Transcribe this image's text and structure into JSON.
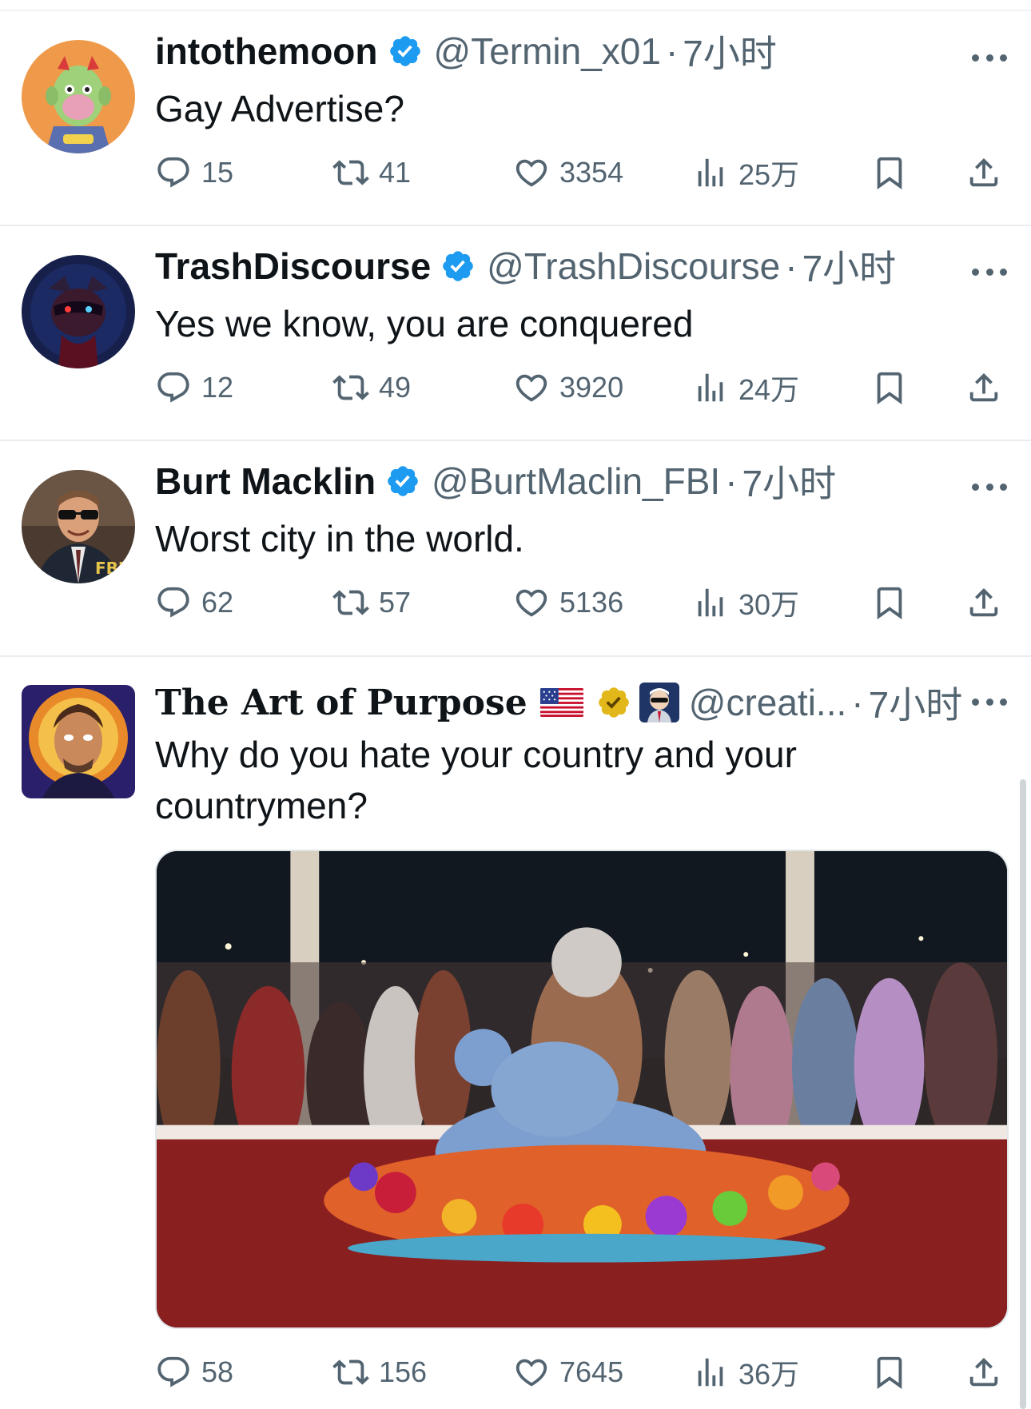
{
  "tweets": [
    {
      "display_name": "intothemoon",
      "handle": "@Termin_x01",
      "dot": "·",
      "time": "7小时",
      "text": "Gay Advertise?",
      "replies": "15",
      "reposts": "41",
      "likes": "3354",
      "views": "25万",
      "avatar_icon": "cartoon-ape-avatar",
      "badge": "verified-blue"
    },
    {
      "display_name": "TrashDiscourse",
      "handle": "@TrashDiscourse",
      "dot": "·",
      "time": "7小时",
      "text": "Yes we know, you are conquered",
      "replies": "12",
      "reposts": "49",
      "likes": "3920",
      "views": "24万",
      "avatar_icon": "raccoon-avatar",
      "badge": "verified-blue"
    },
    {
      "display_name": "Burt Macklin",
      "handle": "@BurtMaclin_FBI",
      "dot": "·",
      "time": "7小时",
      "text": "Worst city in the world.",
      "replies": "62",
      "reposts": "57",
      "likes": "5136",
      "views": "30万",
      "avatar_icon": "man-sunglasses-avatar",
      "badge": "verified-blue",
      "avatar_text": "FBI"
    },
    {
      "display_name": "The Art of Purpose",
      "handle": "@creati...",
      "dot": "·",
      "time": "7小时",
      "text": "Why do you hate your country and your countrymen?",
      "replies": "58",
      "reposts": "156",
      "likes": "7645",
      "views": "36万",
      "avatar_icon": "glowing-face-avatar",
      "badge": "verified-gold",
      "emoji": [
        "us-flag",
        "affiliate-avatar"
      ],
      "media": "photo-performers-banquet-table"
    }
  ],
  "icons": {
    "reply": "reply-icon",
    "repost": "repost-icon",
    "like": "heart-icon",
    "views": "views-icon",
    "bookmark": "bookmark-icon",
    "share": "share-icon",
    "more": "more-icon"
  },
  "colors": {
    "text": "#0f1419",
    "secondary": "#536471",
    "verified_blue": "#1d9bf0",
    "verified_gold": "#e2b719",
    "separator": "#e9edef"
  }
}
